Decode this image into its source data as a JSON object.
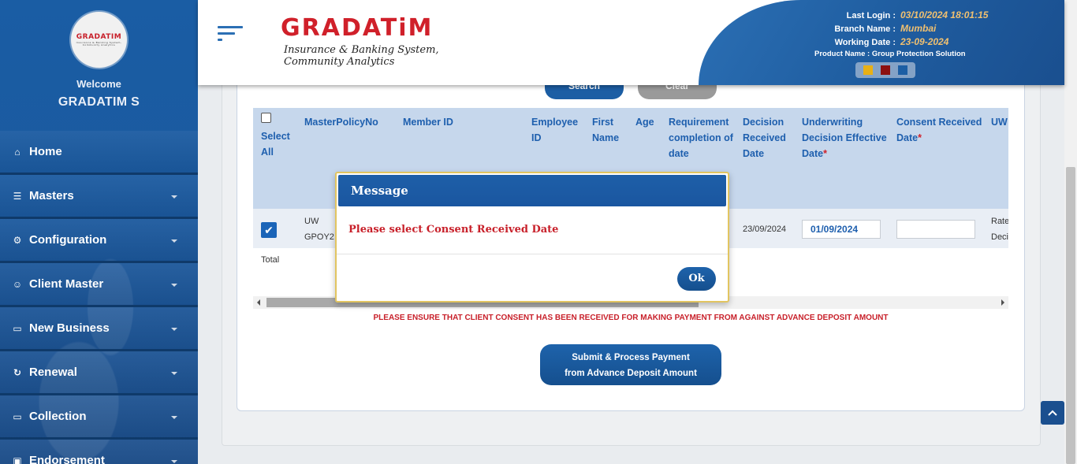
{
  "user": {
    "welcome": "Welcome",
    "name": "GRADATIM S"
  },
  "avatar_logo": {
    "title": "GRADATIM",
    "sub": "Insurance & Banking System, Community Analytics"
  },
  "brand": {
    "title": "GRADATiM",
    "subtitle": "Insurance & Banking System, Community Analytics"
  },
  "header_info": {
    "last_login_label": "Last Login :",
    "last_login_value": "03/10/2024 18:01:15",
    "branch_label": "Branch Name :",
    "branch_value": "Mumbai",
    "working_date_label": "Working Date :",
    "working_date_value": "23-09-2024",
    "product_text": "Product Name : Group Protection Solution"
  },
  "theme_colors": [
    "#e8b015",
    "#8c1010",
    "#1c5ea4"
  ],
  "sidebar": {
    "items": [
      {
        "label": "Home",
        "icon": "home-icon",
        "glyph": "⌂",
        "has_caret": false
      },
      {
        "label": "Masters",
        "icon": "database-icon",
        "glyph": "☰",
        "has_caret": true
      },
      {
        "label": "Configuration",
        "icon": "gears-icon",
        "glyph": "⚙",
        "has_caret": true
      },
      {
        "label": "Client Master",
        "icon": "user-icon",
        "glyph": "☺",
        "has_caret": true
      },
      {
        "label": "New Business",
        "icon": "desktop-icon",
        "glyph": "▭",
        "has_caret": true
      },
      {
        "label": "Renewal",
        "icon": "refresh-icon",
        "glyph": "↻",
        "has_caret": true
      },
      {
        "label": "Collection",
        "icon": "desktop-icon",
        "glyph": "▭",
        "has_caret": true
      },
      {
        "label": "Endorsement",
        "icon": "briefcase-icon",
        "glyph": "▣",
        "has_caret": true
      }
    ]
  },
  "filter_buttons": {
    "search": "Search",
    "clear": "Clear"
  },
  "table": {
    "headers": {
      "select_all": "Select All",
      "master_policy_no": "MasterPolicyNo",
      "member_id": "Member ID",
      "employee_id": "Employee ID",
      "first_name": "First Name",
      "age": "Age",
      "requirement_completion": "Requirement completion of date",
      "decision_received": "Decision Received Date",
      "uw_decision_effective": "Underwriting Decision Effective Date",
      "consent_received": "Consent Received Date",
      "uw": "UW"
    },
    "row": {
      "master_policy_l1": "UW",
      "master_policy_l2": "GPOY2",
      "decision_received": "23/09/2024",
      "uw_effective_date": "01/09/2024",
      "consent_received": "",
      "uw_l1": "Rate",
      "uw_l2": "Deci"
    },
    "total_label": "Total"
  },
  "warning_text": "PLEASE ENSURE THAT CLIENT CONSENT HAS BEEN RECEIVED FOR MAKING PAYMENT FROM AGAINST ADVANCE DEPOSIT AMOUNT",
  "submit_button": {
    "line1": "Submit & Process Payment",
    "line2": "from Advance Deposit Amount"
  },
  "modal": {
    "title": "Message",
    "message": "Please select Consent Received Date",
    "ok_label": "Ok"
  }
}
